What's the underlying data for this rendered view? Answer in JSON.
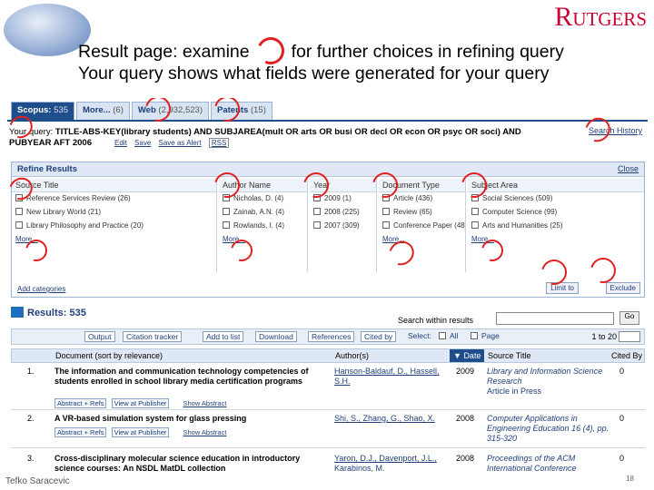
{
  "slide": {
    "brand": "Rutgers",
    "caption_line1_before": "Result page: examine",
    "caption_line1_after": "for further choices in refining query",
    "caption_line2": "Your  query shows what fields were generated for your query",
    "footer_author": "Tefko Saracevic",
    "page_number": "18"
  },
  "tabs": [
    {
      "label": "Scopus:",
      "count": "535"
    },
    {
      "label": "More...",
      "count": "(6)"
    },
    {
      "label": "Web",
      "count": "(2,932,523)"
    },
    {
      "label": "Patents",
      "count": "(15)"
    }
  ],
  "query": {
    "prefix": "Your query:",
    "text_line1": "TITLE-ABS-KEY(library students) AND SUBJAREA(mult OR arts OR busi OR decl OR econ OR psyc OR soci) AND",
    "text_line2": "PUBYEAR AFT 2006",
    "edit": "Edit",
    "save": "Save",
    "save_alert": "Save as Alert",
    "rss": "RSS",
    "search_history": "Search History"
  },
  "refine": {
    "title": "Refine Results",
    "close": "Close",
    "add_categories": "Add categories",
    "limit_to": "Limit to",
    "exclude": "Exclude",
    "facets": [
      {
        "title": "Source Title",
        "items": [
          "Reference Services Review (26)",
          "New Library World (21)",
          "Library Philosophy and Practice (20)"
        ],
        "more": "More..."
      },
      {
        "title": "Author Name",
        "items": [
          "Nicholas, D. (4)",
          "Zainab, A.N. (4)",
          "Rowlands, I. (4)"
        ],
        "more": "More..."
      },
      {
        "title": "Year",
        "items": [
          "2009 (1)",
          "2008 (225)",
          "2007 (309)"
        ],
        "more": ""
      },
      {
        "title": "Document Type",
        "items": [
          "Article (436)",
          "Review (65)",
          "Conference Paper (48)"
        ],
        "more": "More..."
      },
      {
        "title": "Subject Area",
        "items": [
          "Social Sciences (509)",
          "Computer Science (99)",
          "Arts and Humanities (25)"
        ],
        "more": "More..."
      }
    ]
  },
  "results": {
    "label": "Results:",
    "count": "535",
    "search_within": "Search within results",
    "go": "Go",
    "toolbar": {
      "output": "Output",
      "citation_tracker": "Citation tracker",
      "add_to_list": "Add to list",
      "download": "Download",
      "references": "References",
      "cited_by": "Cited by",
      "select": "Select:",
      "all": "All",
      "page": "Page",
      "pager": "1 to 20"
    },
    "columns": {
      "document": "Document (sort by relevance)",
      "authors": "Author(s)",
      "date": "Date",
      "source": "Source Title",
      "cited_by": "Cited By"
    },
    "rows": [
      {
        "num": "1.",
        "title": "The information and communication technology competencies of students enrolled in school library media certification programs",
        "authors": "Hanson-Baldauf, D., Hassell, S.H.",
        "year": "2009",
        "source": "Library and Information Science Research",
        "source_extra": "Article in Press",
        "cited": "0",
        "abstract_refs": "Abstract + Refs",
        "view_publisher": "View at Publisher",
        "show_abstract": "Show Abstract"
      },
      {
        "num": "2.",
        "title": "A VR-based simulation system for glass pressing",
        "authors": "Shi, S., Zhang, G., Shao, X.",
        "year": "2008",
        "source": "Computer Applications in Engineering Education 16 (4), pp. 315-320",
        "source_extra": "",
        "cited": "0",
        "abstract_refs": "Abstract + Refs",
        "view_publisher": "View at Publisher",
        "show_abstract": "Show Abstract"
      },
      {
        "num": "3.",
        "title": "Cross-disciplinary molecular science education in introductory science courses: An NSDL MatDL collection",
        "authors": "Yaron, D.J., Davenport, J.L., Karabinos, M.",
        "year": "2008",
        "source": "Proceedings of the ACM International Conference",
        "source_extra": "",
        "cited": "0",
        "abstract_refs": "",
        "view_publisher": "",
        "show_abstract": ""
      }
    ]
  }
}
